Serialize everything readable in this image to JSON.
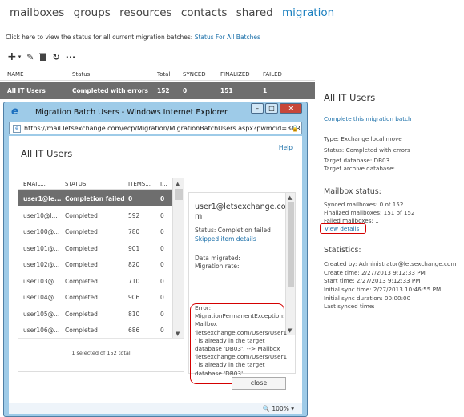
{
  "nav": {
    "items": [
      "mailboxes",
      "groups",
      "resources",
      "contacts",
      "shared",
      "migration"
    ],
    "active": "migration"
  },
  "status_line": {
    "text": "Click here to view the status for all current migration batches:",
    "link": "For All Batches",
    "link_prefix": "Status"
  },
  "toolbar": {
    "add": "+",
    "edit": "✎",
    "delete": "🗑",
    "refresh": "↻",
    "more": "···"
  },
  "table": {
    "headers": [
      "NAME",
      "Status",
      "Total",
      "SYNCED",
      "FINALIZED",
      "FAILED"
    ],
    "row": {
      "name": "All IT Users",
      "status": "Completed with errors",
      "total": "152",
      "synced": "0",
      "finalized": "151",
      "failed": "1"
    }
  },
  "right": {
    "title": "All IT Users",
    "complete_link": "Complete this migration batch",
    "type": "Type: Exchange local move",
    "status": "Status: Completed with errors",
    "target_db": "Target database: DB03",
    "target_archive": "Target archive database:",
    "mailbox_status_heading": "Mailbox status:",
    "synced": "Synced mailboxes: 0 of 152",
    "finalized": "Finalized mailboxes: 151 of 152",
    "failed": "Failed mailboxes: 1",
    "view_details": "View details",
    "statistics_heading": "Statistics:",
    "created_by": "Created by: Administrator@letsexchange.com",
    "create_time": "Create time: 2/27/2013 9:12:33 PM",
    "start_time": "Start time: 2/27/2013 9:12:33 PM",
    "initial_sync": "Initial sync time: 2/27/2013 10:46:55 PM",
    "initial_sync_duration": "Initial sync duration: 00:00:00",
    "last_synced": "Last synced time:"
  },
  "popup": {
    "window_title": "Migration Batch Users - Windows Internet Explorer",
    "url": "https://mail.letsexchange.com/ecp/Migration/MigrationBatchUsers.aspx?pwmcid=3&ReturnI",
    "page_title": "All IT Users",
    "help": "Help",
    "list_headers": [
      "EMAIL...",
      "STATUS",
      "ITEMS...",
      "I..."
    ],
    "rows": [
      {
        "email": "user1@le...",
        "status": "Completion failed",
        "items": "0",
        "i": "0"
      },
      {
        "email": "user10@l...",
        "status": "Completed",
        "items": "592",
        "i": "0"
      },
      {
        "email": "user100@...",
        "status": "Completed",
        "items": "780",
        "i": "0"
      },
      {
        "email": "user101@...",
        "status": "Completed",
        "items": "901",
        "i": "0"
      },
      {
        "email": "user102@...",
        "status": "Completed",
        "items": "820",
        "i": "0"
      },
      {
        "email": "user103@...",
        "status": "Completed",
        "items": "710",
        "i": "0"
      },
      {
        "email": "user104@...",
        "status": "Completed",
        "items": "906",
        "i": "0"
      },
      {
        "email": "user105@...",
        "status": "Completed",
        "items": "810",
        "i": "0"
      },
      {
        "email": "user106@...",
        "status": "Completed",
        "items": "686",
        "i": "0"
      }
    ],
    "footer": "1 selected of 152 total",
    "detail": {
      "user_line1": "user1@letsexchange.co",
      "user_line2": "m",
      "status": "Status: Completion failed",
      "skipped_link": "Skipped item details",
      "data_migrated": "Data migrated:",
      "migration_rate": "Migration rate:",
      "error_lines": [
        "Error:",
        "MigrationPermanentException:",
        "Mailbox",
        "'letsexchange.com/Users/User1",
        "' is already in the target",
        "database 'DB03'. --> Mailbox",
        "'letsexchange.com/Users/User1",
        "' is already in the target",
        "database 'DB03'."
      ]
    },
    "close": "close",
    "zoom": "100%"
  }
}
